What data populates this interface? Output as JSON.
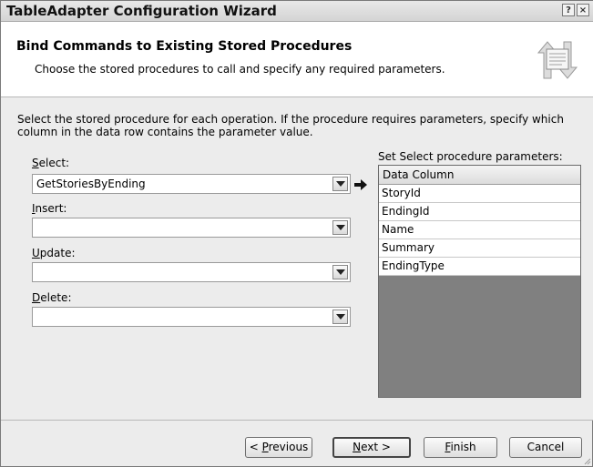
{
  "window": {
    "title": "TableAdapter Configuration Wizard",
    "help_glyph": "?",
    "close_glyph": "×"
  },
  "header": {
    "title": "Bind Commands to Existing Stored Procedures",
    "subtitle": "Choose the stored procedures to call and specify any required parameters.",
    "graphic_icon": "wizard-arrows-icon"
  },
  "body": {
    "instructions": "Select the stored procedure for each operation. If the procedure requires parameters, specify which column in the data row contains the parameter value.",
    "fields": {
      "select": {
        "label_key": "S",
        "label_rest": "elect:",
        "value": "GetStoriesByEnding"
      },
      "insert": {
        "label_key": "I",
        "label_rest": "nsert:",
        "value": ""
      },
      "update": {
        "label_key": "U",
        "label_rest": "pdate:",
        "value": ""
      },
      "delete": {
        "label_key": "D",
        "label_rest": "elete:",
        "value": ""
      }
    },
    "params_label": "Set Select procedure parameters:",
    "grid": {
      "header": "Data Column",
      "rows": [
        "StoryId",
        "EndingId",
        "Name",
        "Summary",
        "EndingType"
      ]
    }
  },
  "buttons": {
    "previous": {
      "pre": "< ",
      "key": "P",
      "rest": "revious"
    },
    "next": {
      "key": "N",
      "rest": "ext >"
    },
    "finish": {
      "key": "F",
      "rest": "inish"
    },
    "cancel": "Cancel"
  },
  "colors": {
    "grid_background": "#808080",
    "window_background": "#ececec"
  }
}
